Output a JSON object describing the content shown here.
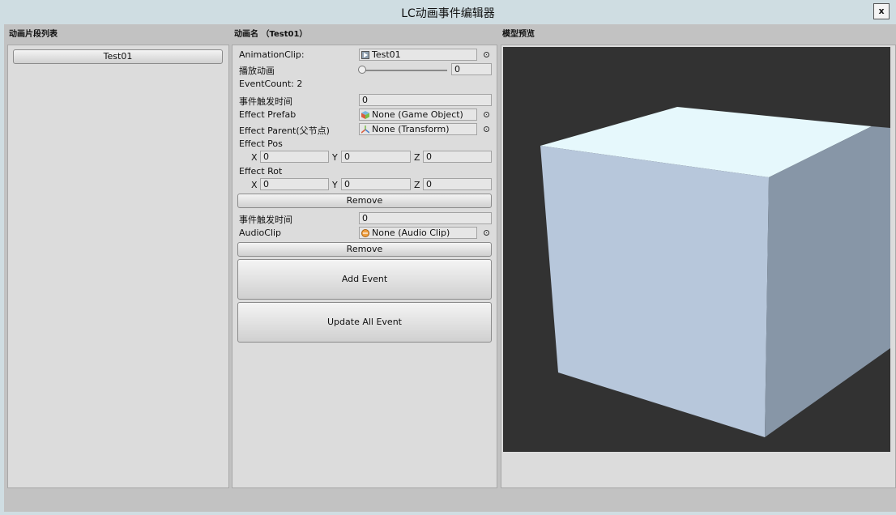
{
  "window": {
    "title": "LC动画事件编辑器",
    "close_label": "x"
  },
  "clip_list": {
    "header": "动画片段列表",
    "items": [
      "Test01"
    ]
  },
  "editor": {
    "header": "动画名 （Test01）",
    "animation_clip_label": "AnimationClip:",
    "animation_clip_value": "Test01",
    "play_label": "播放动画",
    "play_slider_value": 0,
    "play_value": "0",
    "event_count_label": "EventCount: 2",
    "events": [
      {
        "time_label": "事件触发时间",
        "time_value": "0",
        "prefab_label": "Effect Prefab",
        "prefab_value": "None (Game Object)",
        "parent_label": "Effect Parent(父节点)",
        "parent_value": "None (Transform)",
        "pos_label": "Effect Pos",
        "pos": {
          "x_label": "X",
          "x": "0",
          "y_label": "Y",
          "y": "0",
          "z_label": "Z",
          "z": "0"
        },
        "rot_label": "Effect Rot",
        "rot": {
          "x_label": "X",
          "x": "0",
          "y_label": "Y",
          "y": "0",
          "z_label": "Z",
          "z": "0"
        },
        "remove_label": "Remove"
      },
      {
        "time_label": "事件触发时间",
        "time_value": "0",
        "audio_label": "AudioClip",
        "audio_value": "None (Audio Clip)",
        "remove_label": "Remove"
      }
    ],
    "add_event_label": "Add Event",
    "update_all_label": "Update All Event"
  },
  "preview": {
    "header": "模型预览",
    "background_color": "#323232",
    "cube_top_color": "#e6f8fc",
    "cube_front_color": "#b7c7db",
    "cube_side_color": "#8796a7"
  }
}
